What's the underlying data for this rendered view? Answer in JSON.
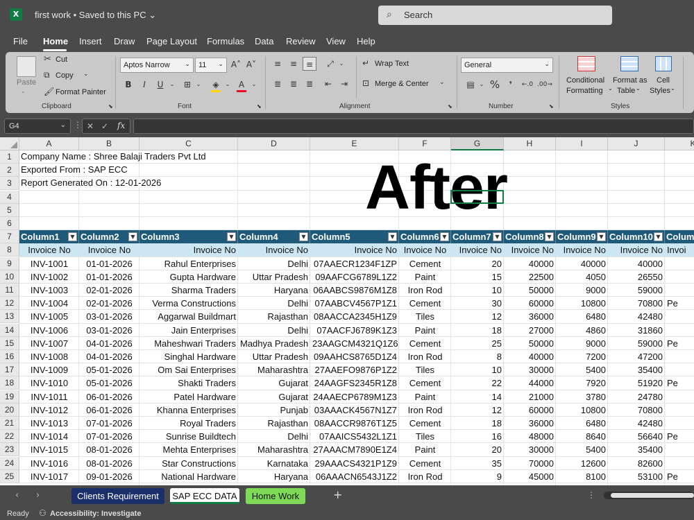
{
  "titlebar": {
    "app_icon_letter": "X",
    "doc_title": "first work • Saved to this PC ⌄",
    "search_placeholder": "Search"
  },
  "menu": [
    "File",
    "Home",
    "Insert",
    "Draw",
    "Page Layout",
    "Formulas",
    "Data",
    "Review",
    "View",
    "Help"
  ],
  "menu_active": "Home",
  "ribbon": {
    "clipboard": {
      "paste": "Paste",
      "cut": "Cut",
      "copy": "Copy",
      "format_painter": "Format Painter",
      "label": "Clipboard"
    },
    "font": {
      "name": "Aptos Narrow",
      "size": "11",
      "label": "Font",
      "bold": "B",
      "italic": "I",
      "underline": "U"
    },
    "alignment": {
      "wrap": "Wrap Text",
      "merge": "Merge & Center",
      "label": "Alignment"
    },
    "number": {
      "format": "General",
      "label": "Number",
      "percent": "%"
    },
    "styles": {
      "conditional": "Conditional",
      "conditional2": "Formatting",
      "format_as": "Format as",
      "table": "Table",
      "cell": "Cell",
      "cell2": "Styles",
      "label": "Styles"
    },
    "icon_colors": {
      "fill": "#ffd400",
      "font_color": "#e81123"
    }
  },
  "formula_bar": {
    "cell_ref": "G4",
    "fx": "fx",
    "value": ""
  },
  "grid": {
    "columns": [
      "A",
      "B",
      "C",
      "D",
      "E",
      "F",
      "G",
      "H",
      "I",
      "J",
      "K"
    ],
    "selected_column": "G",
    "row_numbers": [
      "1",
      "2",
      "3",
      "4",
      "5",
      "6",
      "7",
      "8",
      "9",
      "10",
      "11",
      "12",
      "13",
      "14",
      "15",
      "16",
      "17",
      "18",
      "19",
      "20",
      "21",
      "22",
      "23",
      "24",
      "25"
    ],
    "info": {
      "company": "Company Name : Shree Balaji Traders Pvt Ltd",
      "exported": "Exported From : SAP ECC",
      "report": "Report Generated On : 12-01-2026"
    },
    "overlay_text": "After",
    "table_headers": [
      "Column1",
      "Column2",
      "Column3",
      "Column4",
      "Column5",
      "Column6",
      "Column7",
      "Column8",
      "Column9",
      "Column10",
      "Colum"
    ],
    "sub_headers": [
      "Invoice No",
      "Invoice No",
      "Invoice No",
      "Invoice No",
      "Invoice No",
      "Invoice No",
      "Invoice No",
      "Invoice No",
      "Invoice No",
      "Invoice No",
      "Invoi"
    ],
    "rows": [
      [
        "INV-1001",
        "01-01-2026",
        "Rahul Enterprises",
        "Delhi",
        "07AAECR1234F1ZP",
        "Cement",
        "20",
        "40000",
        "40000",
        "40000",
        ""
      ],
      [
        "INV-1002",
        "01-01-2026",
        "Gupta Hardware",
        "Uttar Pradesh",
        "09AAFCG6789L1Z2",
        "Paint",
        "15",
        "22500",
        "4050",
        "26550",
        ""
      ],
      [
        "INV-1003",
        "02-01-2026",
        "Sharma Traders",
        "Haryana",
        "06AABCS9876M1Z8",
        "Iron Rod",
        "10",
        "50000",
        "9000",
        "59000",
        ""
      ],
      [
        "INV-1004",
        "02-01-2026",
        "Verma Constructions",
        "Delhi",
        "07AABCV4567P1Z1",
        "Cement",
        "30",
        "60000",
        "10800",
        "70800",
        "Pe"
      ],
      [
        "INV-1005",
        "03-01-2026",
        "Aggarwal Buildmart",
        "Rajasthan",
        "08AACCA2345H1Z9",
        "Tiles",
        "12",
        "36000",
        "6480",
        "42480",
        ""
      ],
      [
        "INV-1006",
        "03-01-2026",
        "Jain Enterprises",
        "Delhi",
        "07AACFJ6789K1Z3",
        "Paint",
        "18",
        "27000",
        "4860",
        "31860",
        ""
      ],
      [
        "INV-1007",
        "04-01-2026",
        "Maheshwari Traders",
        "Madhya Pradesh",
        "23AAGCM4321Q1Z6",
        "Cement",
        "25",
        "50000",
        "9000",
        "59000",
        "Pe"
      ],
      [
        "INV-1008",
        "04-01-2026",
        "Singhal Hardware",
        "Uttar Pradesh",
        "09AAHCS8765D1Z4",
        "Iron Rod",
        "8",
        "40000",
        "7200",
        "47200",
        ""
      ],
      [
        "INV-1009",
        "05-01-2026",
        "Om Sai Enterprises",
        "Maharashtra",
        "27AAEFO9876P1Z2",
        "Tiles",
        "10",
        "30000",
        "5400",
        "35400",
        ""
      ],
      [
        "INV-1010",
        "05-01-2026",
        "Shakti Traders",
        "Gujarat",
        "24AAGFS2345R1Z8",
        "Cement",
        "22",
        "44000",
        "7920",
        "51920",
        "Pe"
      ],
      [
        "INV-1011",
        "06-01-2026",
        "Patel Hardware",
        "Gujarat",
        "24AAECP6789M1Z3",
        "Paint",
        "14",
        "21000",
        "3780",
        "24780",
        ""
      ],
      [
        "INV-1012",
        "06-01-2026",
        "Khanna Enterprises",
        "Punjab",
        "03AAACK4567N1Z7",
        "Iron Rod",
        "12",
        "60000",
        "10800",
        "70800",
        ""
      ],
      [
        "INV-1013",
        "07-01-2026",
        "Royal Traders",
        "Rajasthan",
        "08AACCR9876T1Z5",
        "Cement",
        "18",
        "36000",
        "6480",
        "42480",
        ""
      ],
      [
        "INV-1014",
        "07-01-2026",
        "Sunrise Buildtech",
        "Delhi",
        "07AAICS5432L1Z1",
        "Tiles",
        "16",
        "48000",
        "8640",
        "56640",
        "Pe"
      ],
      [
        "INV-1015",
        "08-01-2026",
        "Mehta Enterprises",
        "Maharashtra",
        "27AAACM7890E1Z4",
        "Paint",
        "20",
        "30000",
        "5400",
        "35400",
        ""
      ],
      [
        "INV-1016",
        "08-01-2026",
        "Star Constructions",
        "Karnataka",
        "29AAACS4321P1Z9",
        "Cement",
        "35",
        "70000",
        "12600",
        "82600",
        ""
      ],
      [
        "INV-1017",
        "09-01-2026",
        "National Hardware",
        "Haryana",
        "06AAACN6543J1Z2",
        "Iron Rod",
        "9",
        "45000",
        "8100",
        "53100",
        "Pe"
      ]
    ]
  },
  "tabs": {
    "clients": "Clients Requirement",
    "sap": "SAP ECC DATA",
    "home": "Home Work",
    "add": "+"
  },
  "status": {
    "ready": "Ready",
    "accessibility": "Accessibility: Investigate"
  }
}
